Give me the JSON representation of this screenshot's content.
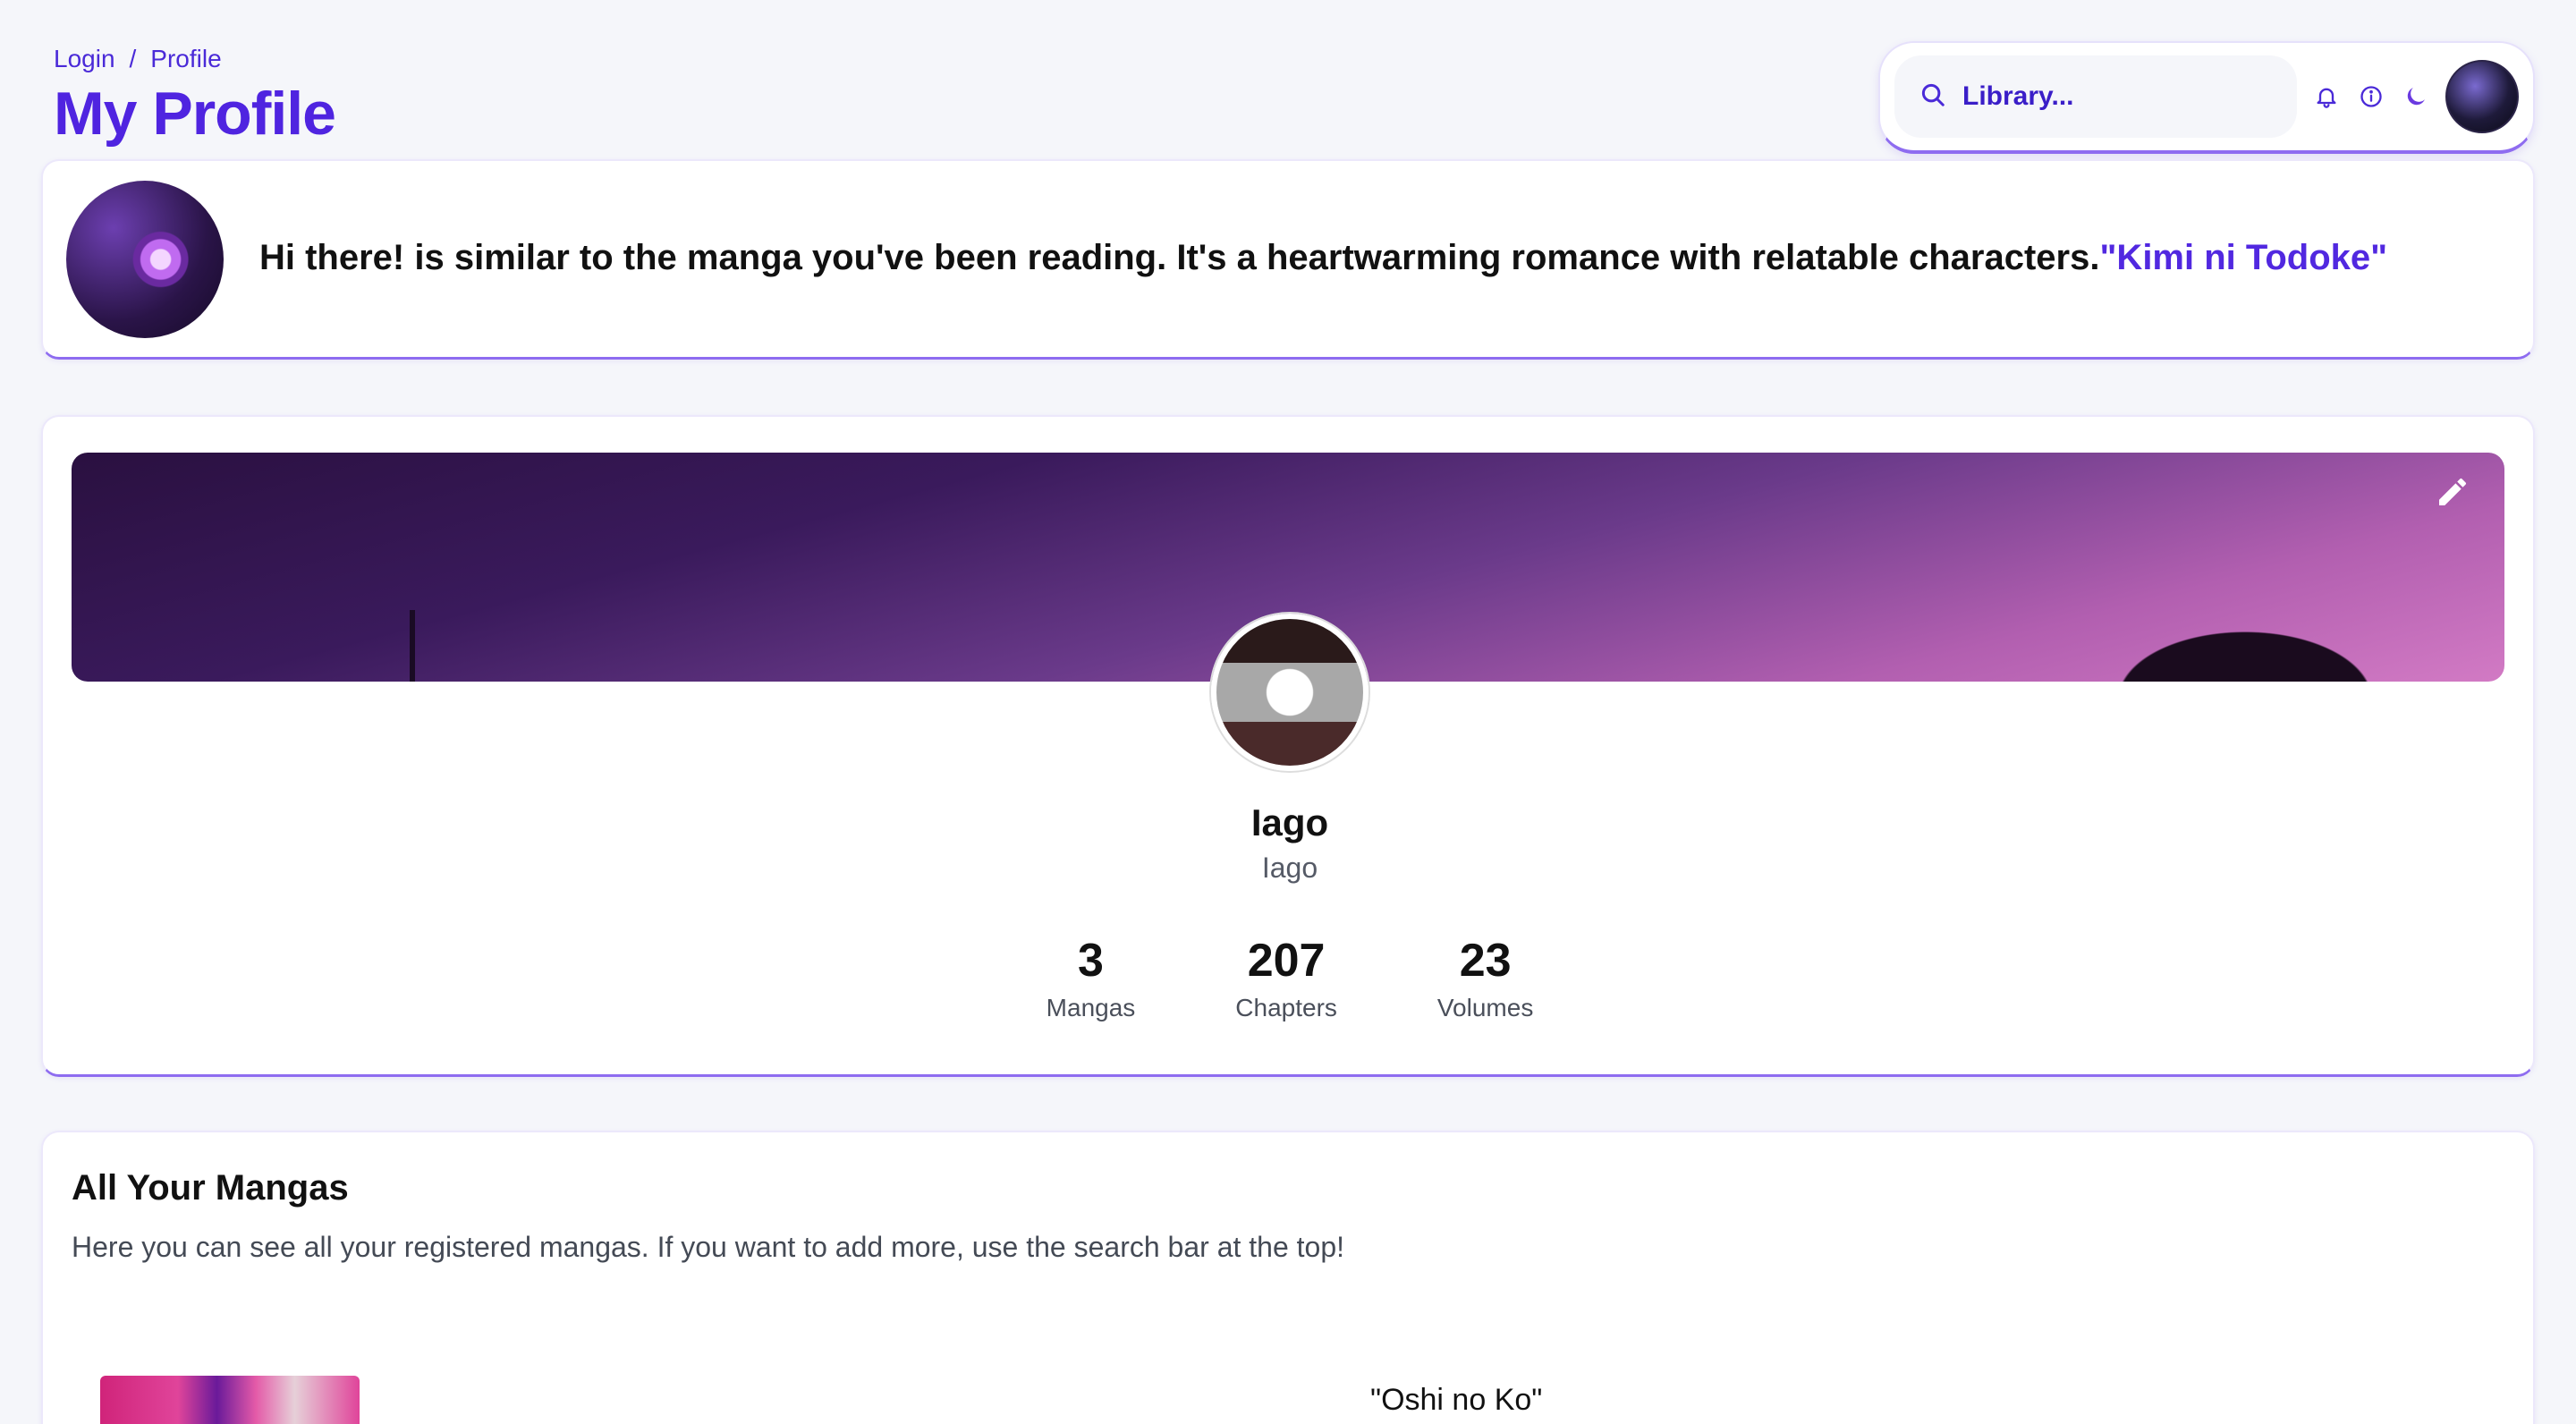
{
  "breadcrumb": {
    "items": [
      "Login",
      "Profile"
    ],
    "separator": "/"
  },
  "header": {
    "title": "My Profile"
  },
  "toolbar": {
    "search_placeholder": "Library...",
    "icons": [
      "search-icon",
      "bell-icon",
      "info-icon",
      "moon-icon"
    ]
  },
  "recommendation": {
    "text": "Hi there! is similar to the manga you've been reading. It's a heartwarming romance with relatable characters.",
    "highlight": "\"Kimi ni Todoke\""
  },
  "profile": {
    "name": "Iago",
    "handle": "Iago",
    "stats": [
      {
        "value": "3",
        "label": "Mangas"
      },
      {
        "value": "207",
        "label": "Chapters"
      },
      {
        "value": "23",
        "label": "Volumes"
      }
    ]
  },
  "mangas": {
    "title": "All Your Mangas",
    "description": "Here you can see all your registered mangas. If you want to add more, use the search bar at the top!",
    "items": [
      {
        "title": "\"Oshi no Ko\""
      }
    ]
  },
  "colors": {
    "accent": "#4f24e0",
    "border_accent": "#8e6cf0",
    "background": "#f5f6fa"
  }
}
